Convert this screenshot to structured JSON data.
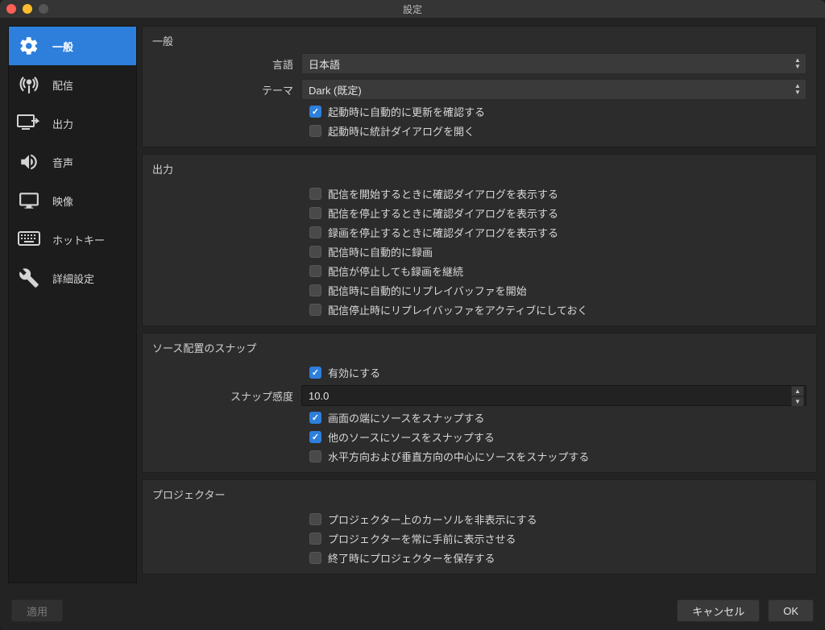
{
  "window": {
    "title": "設定"
  },
  "sidebar": {
    "items": [
      {
        "label": "一般"
      },
      {
        "label": "配信"
      },
      {
        "label": "出力"
      },
      {
        "label": "音声"
      },
      {
        "label": "映像"
      },
      {
        "label": "ホットキー"
      },
      {
        "label": "詳細設定"
      }
    ]
  },
  "general": {
    "title": "一般",
    "language_label": "言語",
    "language_value": "日本語",
    "theme_label": "テーマ",
    "theme_value": "Dark (既定)",
    "check_updates": "起動時に自動的に更新を確認する",
    "open_stats": "起動時に統計ダイアログを開く"
  },
  "output": {
    "title": "出力",
    "opts": [
      "配信を開始するときに確認ダイアログを表示する",
      "配信を停止するときに確認ダイアログを表示する",
      "録画を停止するときに確認ダイアログを表示する",
      "配信時に自動的に録画",
      "配信が停止しても録画を継続",
      "配信時に自動的にリプレイバッファを開始",
      "配信停止時にリプレイバッファをアクティブにしておく"
    ]
  },
  "snap": {
    "title": "ソース配置のスナップ",
    "enable": "有効にする",
    "sensitivity_label": "スナップ感度",
    "sensitivity_value": "10.0",
    "edge": "画面の端にソースをスナップする",
    "other": "他のソースにソースをスナップする",
    "center": "水平方向および垂直方向の中心にソースをスナップする"
  },
  "projector": {
    "title": "プロジェクター",
    "hide_cursor": "プロジェクター上のカーソルを非表示にする",
    "always_on_top": "プロジェクターを常に手前に表示させる",
    "save_on_exit": "終了時にプロジェクターを保存する"
  },
  "footer": {
    "apply": "適用",
    "cancel": "キャンセル",
    "ok": "OK"
  }
}
